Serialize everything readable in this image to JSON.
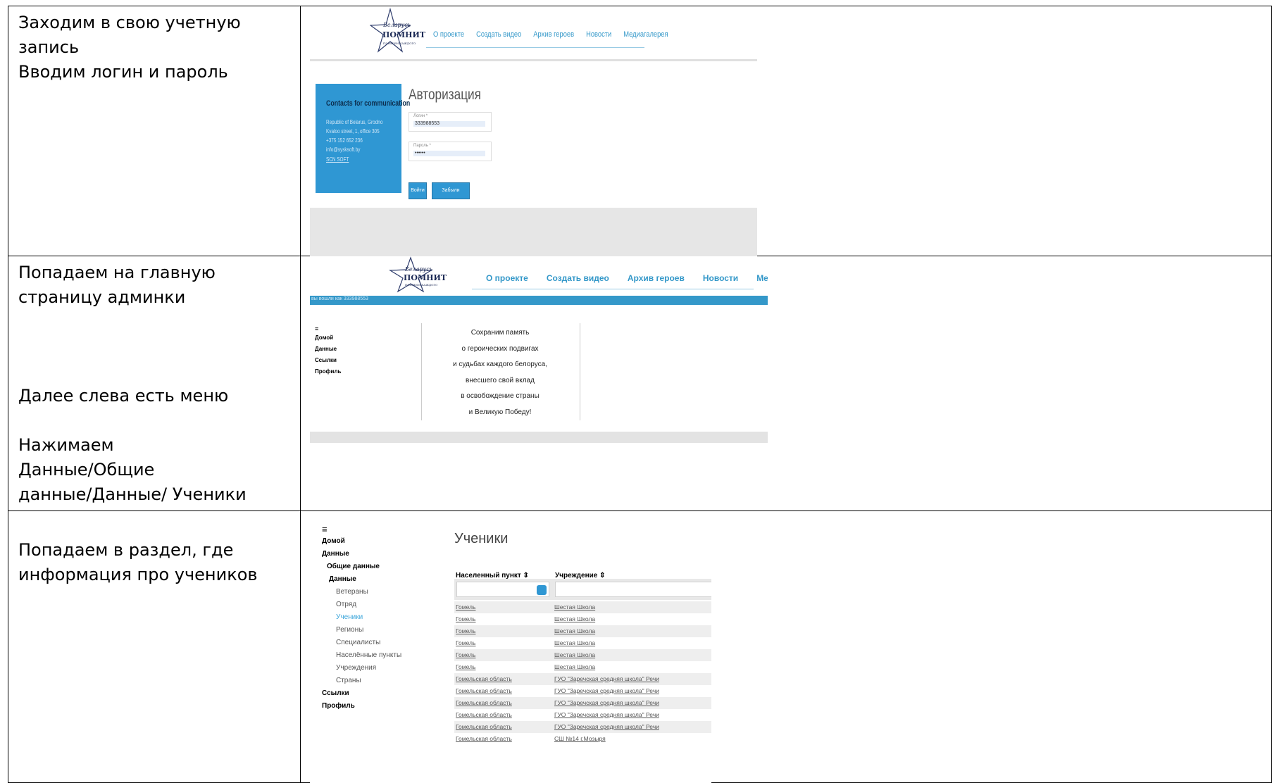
{
  "rows": [
    {
      "instruction": [
        "Заходим в свою учетную",
        "запись",
        "Вводим логин и пароль"
      ],
      "shot": {
        "logo_top": "Беларусь",
        "logo_main": "ПОМНИТ",
        "logo_sub": "ПОМНИМ КАЖДОГО",
        "nav": [
          "О проекте",
          "Создать видео",
          "Архив героев",
          "Новости",
          "Медиагалерея"
        ],
        "contact_title": "Contacts for communication",
        "contact_lines": [
          "Republic of Belarus, Grodno",
          "Kvaloo street, 1, office 305",
          "+375 152 652 236",
          "info@sysksoft.by",
          "SCN SOFT"
        ],
        "auth_title": "Авторизация",
        "login_label": "Логин *",
        "login_value": "333988553",
        "password_label": "Пароль *",
        "password_value": "••••••",
        "login_button": "Войти",
        "forgot_button": "Забыли пароль?"
      }
    },
    {
      "instruction_top": [
        "Попадаем на главную",
        "страницу админки"
      ],
      "instruction_mid": [
        "Далее слева есть меню"
      ],
      "instruction_bottom": [
        "Нажимаем",
        "Данные/Общие",
        "данные/Данные/ Ученики"
      ],
      "shot": {
        "nav": [
          "О проекте",
          "Создать видео",
          "Архив героев",
          "Новости",
          "Медиагалерея"
        ],
        "bar_text": "вы вошли как 333988553",
        "menu": [
          "≡",
          "Домой",
          "Данные",
          "Ссылки",
          "Профиль"
        ],
        "slogan": [
          "Сохраним память",
          "о героических подвигах",
          "и судьбах каждого белоруса,",
          "внесшего свой вклад",
          "в освобождение страны",
          "и Великую Победу!"
        ]
      }
    },
    {
      "instruction": [
        "Попадаем в раздел, где",
        "информация про учеников"
      ],
      "shot": {
        "menu": {
          "hamburger": "≡",
          "home": "Домой",
          "data": "Данные",
          "general": "Общие данные",
          "data_sub": "Данные",
          "items": [
            "Ветераны",
            "Отряд"
          ],
          "active": "Ученики",
          "items2": [
            "Регионы",
            "Специалисты",
            "Населённые пункты",
            "Учреждения",
            "Страны"
          ],
          "links": "Ссылки",
          "profile": "Профиль"
        },
        "title": "Ученики",
        "col1": "Населенный пункт ⇕",
        "col2": "Учреждение ⇕",
        "table": [
          [
            "Гомель",
            "Шестая Школа"
          ],
          [
            "Гомель",
            "Шестая Школа"
          ],
          [
            "Гомель",
            "Шестая Школа"
          ],
          [
            "Гомель",
            "Шестая Школа"
          ],
          [
            "Гомель",
            "Шестая Школа"
          ],
          [
            "Гомель",
            "Шестая Школа"
          ],
          [
            "Гомельская область",
            "ГУО \"Заречская средняя школа\" Речи"
          ],
          [
            "Гомельская область",
            "ГУО \"Заречская средняя школа\" Речи"
          ],
          [
            "Гомельская область",
            "ГУО \"Заречская средняя школа\" Речи"
          ],
          [
            "Гомельская область",
            "ГУО \"Заречская средняя школа\" Речи"
          ],
          [
            "Гомельская область",
            "ГУО \"Заречская средняя школа\" Речи"
          ],
          [
            "Гомельская область",
            "СШ №14 г.Мозыря"
          ]
        ]
      }
    }
  ]
}
